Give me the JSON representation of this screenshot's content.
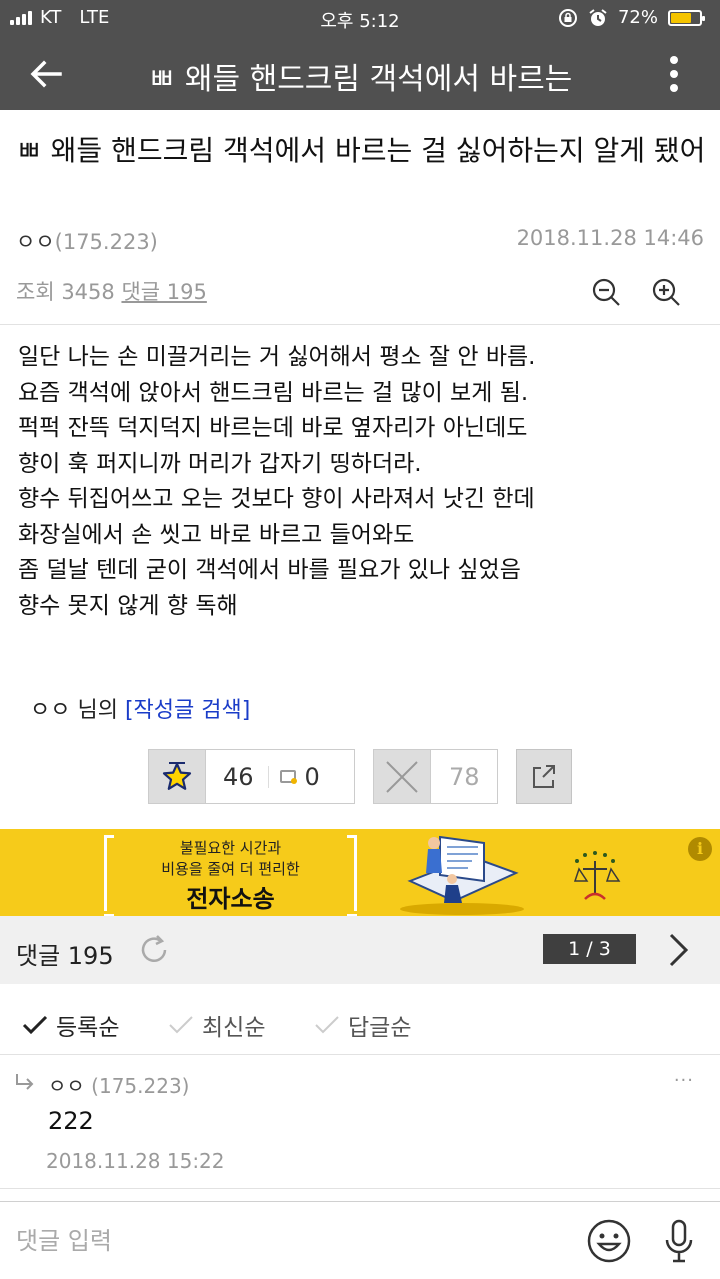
{
  "status_bar": {
    "carrier": "KT",
    "network": "LTE",
    "time": "오후 5:12",
    "battery": "72%",
    "battery_level": 0.72
  },
  "app_bar": {
    "title": "ㅃ 왜들 핸드크림 객석에서 바르는"
  },
  "post": {
    "title": "ㅃ 왜들 핸드크림 객석에서 바르는 걸 싫어하는지 알게 됐어",
    "author_nick": "ㅇㅇ",
    "author_ip": "(175.223)",
    "date": "2018.11.28 14:46",
    "views_label": "조회 3458",
    "comments_label": "댓글 195",
    "body_lines": [
      "일단 나는 손 미끌거리는 거 싫어해서 평소 잘 안 바름.",
      "요즘 객석에 앉아서 핸드크림 바르는 걸 많이 보게 됨.",
      "퍽퍽 잔뜩 덕지덕지 바르는데 바로 옆자리가 아닌데도",
      "향이 훅 퍼지니까 머리가 갑자기 띵하더라.",
      "향수 뒤집어쓰고 오는 것보다 향이 사라져서 낫긴 한데",
      "화장실에서 손 씻고 바로 바르고 들어와도",
      "좀 덜날 텐데 굳이 객석에서 바를 필요가 있나 싶었음",
      "향수 못지 않게 향 독해"
    ],
    "author_search_nick": "ㅇㅇ 님의",
    "author_search_link": "[작성글 검색]"
  },
  "votes": {
    "up_count": "46",
    "fixed_count": "0",
    "down_count": "78"
  },
  "ad": {
    "line1": "불필요한 시간과",
    "line2": "비용을 줄여 더 편리한",
    "line3": "전자소송",
    "info_icon": "i"
  },
  "comments": {
    "header_label": "댓글 195",
    "page": "1 / 3",
    "sort_options": [
      {
        "label": "등록순",
        "active": true
      },
      {
        "label": "최신순",
        "active": false
      },
      {
        "label": "답글순",
        "active": false
      }
    ],
    "items": [
      {
        "nick": "ㅇㅇ",
        "ip": "(175.223)",
        "text": "222",
        "date": "2018.11.28 15:22",
        "menu": "···"
      }
    ]
  },
  "input": {
    "placeholder": "댓글 입력"
  },
  "colors": {
    "bar_bg": "#505050",
    "ad_yellow": "#f6cb1a",
    "link_blue": "#1a3cc8",
    "pager_bg": "#3f3f3f"
  }
}
